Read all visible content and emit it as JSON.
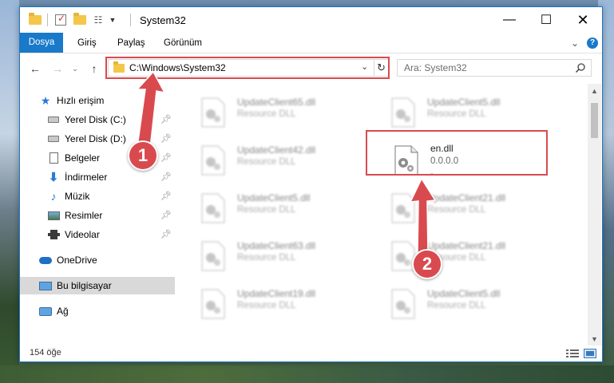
{
  "window": {
    "title": "System32"
  },
  "ribbon": {
    "tabs": [
      "Dosya",
      "Giriş",
      "Paylaş",
      "Görünüm"
    ]
  },
  "address": {
    "path": "C:\\Windows\\System32"
  },
  "search": {
    "placeholder": "Ara: System32"
  },
  "nav": {
    "quick_access": "Hızlı erişim",
    "items": [
      {
        "label": "Yerel Disk (C:)"
      },
      {
        "label": "Yerel Disk (D:)"
      },
      {
        "label": "Belgeler"
      },
      {
        "label": "İndirmeler"
      },
      {
        "label": "Müzik"
      },
      {
        "label": "Resimler"
      },
      {
        "label": "Videolar"
      }
    ],
    "onedrive": "OneDrive",
    "this_pc": "Bu bilgisayar",
    "network": "Ağ"
  },
  "files": {
    "left": [
      {
        "name": "UpdateClient65.dll",
        "type": "Resource DLL"
      },
      {
        "name": "UpdateClient42.dll",
        "type": "Resource DLL"
      },
      {
        "name": "UpdateClient5.dll",
        "type": "Resource DLL"
      },
      {
        "name": "UpdateClient63.dll",
        "type": "Resource DLL"
      },
      {
        "name": "UpdateClient19.dll",
        "type": "Resource DLL"
      }
    ],
    "right": [
      {
        "name": "UpdateClient5.dll",
        "type": "Resource DLL"
      },
      {
        "name": "UpdateClient21.dll",
        "type": "Resource DLL"
      },
      {
        "name": "UpdateClient21.dll",
        "type": "Resource DLL"
      },
      {
        "name": "UpdateClient5.dll",
        "type": "Resource DLL"
      }
    ],
    "highlighted": {
      "name": "en.dll",
      "version": "0.0.0.0",
      "extra": "-"
    }
  },
  "status": {
    "count": "154 öğe"
  },
  "annotations": {
    "badge1": "1",
    "badge2": "2",
    "color": "#d94a4f"
  },
  "colors": {
    "accent": "#1979ca",
    "highlight": "#d94a4f"
  }
}
